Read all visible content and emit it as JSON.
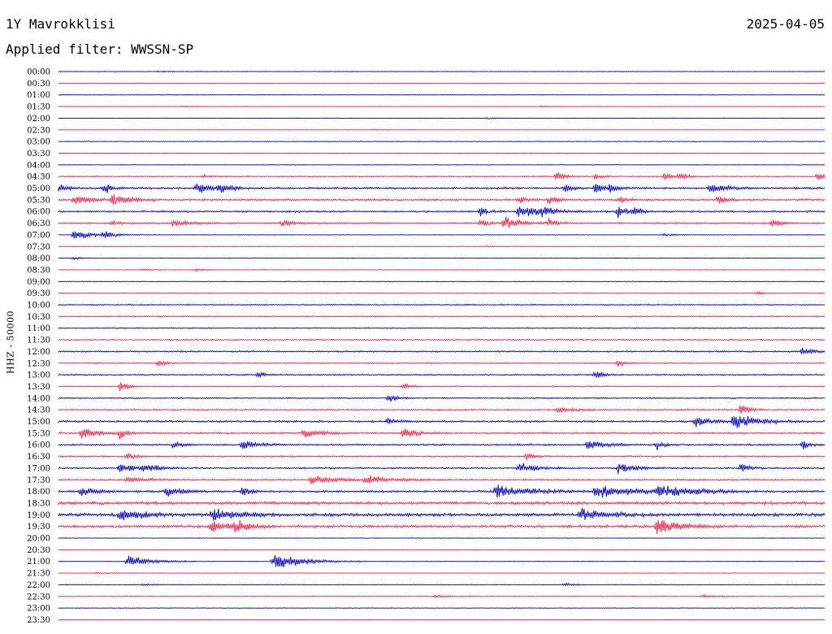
{
  "header": {
    "station": "1Y Mavrokklisi",
    "date": "2025-04-05",
    "filter": "Applied filter: WWSSN-SP"
  },
  "chart_data": {
    "type": "helicorder",
    "ylabel": "HHZ - 50000",
    "line_colors": [
      "#0000cc",
      "#ff1f4b"
    ],
    "rows": [
      {
        "time": "00:00",
        "noise": 0.3,
        "events": [
          {
            "x": 0.13,
            "a": 0.15,
            "w": 0.02
          }
        ]
      },
      {
        "time": "00:30",
        "noise": 0.2,
        "events": []
      },
      {
        "time": "01:00",
        "noise": 0.3,
        "events": []
      },
      {
        "time": "01:30",
        "noise": 0.3,
        "events": [
          {
            "x": 0.16,
            "a": 0.2,
            "w": 0.03
          },
          {
            "x": 0.63,
            "a": 0.2,
            "w": 0.02
          }
        ]
      },
      {
        "time": "02:00",
        "noise": 0.3,
        "events": [
          {
            "x": 0.56,
            "a": 0.3,
            "w": 0.01
          }
        ]
      },
      {
        "time": "02:30",
        "noise": 0.2,
        "events": [
          {
            "x": 0.41,
            "a": 0.15,
            "w": 0.02
          }
        ]
      },
      {
        "time": "03:00",
        "noise": 0.4,
        "events": []
      },
      {
        "time": "03:30",
        "noise": 0.2,
        "events": []
      },
      {
        "time": "04:00",
        "noise": 0.3,
        "events": []
      },
      {
        "time": "04:30",
        "noise": 0.8,
        "events": [
          {
            "x": 0.19,
            "a": 0.4,
            "w": 0.01
          },
          {
            "x": 0.65,
            "a": 1.6,
            "w": 0.01
          },
          {
            "x": 0.7,
            "a": 0.8,
            "w": 0.01
          },
          {
            "x": 0.79,
            "a": 1.5,
            "w": 0.01
          },
          {
            "x": 0.81,
            "a": 1.3,
            "w": 0.01
          },
          {
            "x": 0.99,
            "a": 1.6,
            "w": 0.01
          }
        ]
      },
      {
        "time": "05:00",
        "noise": 1.2,
        "events": [
          {
            "x": 0.0,
            "a": 1.5,
            "w": 0.01
          },
          {
            "x": 0.06,
            "a": 2.0,
            "w": 0.01
          },
          {
            "x": 0.18,
            "a": 1.8,
            "w": 0.02
          },
          {
            "x": 0.21,
            "a": 2.2,
            "w": 0.01
          },
          {
            "x": 0.66,
            "a": 1.6,
            "w": 0.01
          },
          {
            "x": 0.7,
            "a": 1.8,
            "w": 0.01
          },
          {
            "x": 0.72,
            "a": 1.5,
            "w": 0.01
          },
          {
            "x": 0.85,
            "a": 1.5,
            "w": 0.02
          }
        ]
      },
      {
        "time": "05:30",
        "noise": 1.2,
        "events": [
          {
            "x": 0.02,
            "a": 1.5,
            "w": 0.02
          },
          {
            "x": 0.07,
            "a": 2.0,
            "w": 0.02
          },
          {
            "x": 0.6,
            "a": 1.2,
            "w": 0.01
          },
          {
            "x": 0.64,
            "a": 1.5,
            "w": 0.01
          },
          {
            "x": 0.73,
            "a": 1.2,
            "w": 0.01
          },
          {
            "x": 0.86,
            "a": 1.5,
            "w": 0.01
          }
        ]
      },
      {
        "time": "06:00",
        "noise": 1.0,
        "events": [
          {
            "x": 0.55,
            "a": 1.6,
            "w": 0.01
          },
          {
            "x": 0.6,
            "a": 2.0,
            "w": 0.03
          },
          {
            "x": 0.63,
            "a": 1.6,
            "w": 0.01
          },
          {
            "x": 0.73,
            "a": 2.2,
            "w": 0.01
          },
          {
            "x": 0.75,
            "a": 1.8,
            "w": 0.01
          }
        ]
      },
      {
        "time": "06:30",
        "noise": 0.9,
        "events": [
          {
            "x": 0.07,
            "a": 1.2,
            "w": 0.01
          },
          {
            "x": 0.15,
            "a": 1.4,
            "w": 0.02
          },
          {
            "x": 0.29,
            "a": 1.0,
            "w": 0.02
          },
          {
            "x": 0.55,
            "a": 1.5,
            "w": 0.01
          },
          {
            "x": 0.58,
            "a": 2.4,
            "w": 0.02
          },
          {
            "x": 0.64,
            "a": 1.5,
            "w": 0.01
          },
          {
            "x": 0.93,
            "a": 1.6,
            "w": 0.01
          }
        ]
      },
      {
        "time": "07:00",
        "noise": 0.3,
        "events": [
          {
            "x": 0.02,
            "a": 1.6,
            "w": 0.03
          },
          {
            "x": 0.06,
            "a": 1.2,
            "w": 0.01
          },
          {
            "x": 0.79,
            "a": 0.4,
            "w": 0.02
          }
        ]
      },
      {
        "time": "07:30",
        "noise": 0.2,
        "events": [
          {
            "x": 0.56,
            "a": 0.2,
            "w": 0.02
          }
        ]
      },
      {
        "time": "08:00",
        "noise": 0.4,
        "events": [
          {
            "x": 0.02,
            "a": 0.6,
            "w": 0.01
          }
        ]
      },
      {
        "time": "08:30",
        "noise": 0.3,
        "events": [
          {
            "x": 0.11,
            "a": 0.4,
            "w": 0.01
          },
          {
            "x": 0.18,
            "a": 0.5,
            "w": 0.01
          }
        ]
      },
      {
        "time": "09:00",
        "noise": 0.3,
        "events": []
      },
      {
        "time": "09:30",
        "noise": 0.3,
        "events": [
          {
            "x": 0.91,
            "a": 0.6,
            "w": 0.01
          }
        ]
      },
      {
        "time": "10:00",
        "noise": 0.7,
        "events": []
      },
      {
        "time": "10:30",
        "noise": 0.7,
        "events": []
      },
      {
        "time": "11:00",
        "noise": 0.7,
        "events": []
      },
      {
        "time": "11:30",
        "noise": 0.8,
        "events": []
      },
      {
        "time": "12:00",
        "noise": 0.9,
        "events": [
          {
            "x": 0.97,
            "a": 1.0,
            "w": 0.02
          }
        ]
      },
      {
        "time": "12:30",
        "noise": 0.7,
        "events": [
          {
            "x": 0.13,
            "a": 1.0,
            "w": 0.01
          },
          {
            "x": 0.73,
            "a": 1.1,
            "w": 0.01
          }
        ]
      },
      {
        "time": "13:00",
        "noise": 0.8,
        "events": [
          {
            "x": 0.26,
            "a": 1.0,
            "w": 0.01
          },
          {
            "x": 0.7,
            "a": 1.5,
            "w": 0.01
          }
        ]
      },
      {
        "time": "13:30",
        "noise": 0.6,
        "events": [
          {
            "x": 0.08,
            "a": 1.5,
            "w": 0.01
          },
          {
            "x": 0.45,
            "a": 1.2,
            "w": 0.01
          }
        ]
      },
      {
        "time": "14:00",
        "noise": 0.8,
        "events": [
          {
            "x": 0.43,
            "a": 1.4,
            "w": 0.01
          }
        ]
      },
      {
        "time": "14:30",
        "noise": 0.9,
        "events": [
          {
            "x": 0.65,
            "a": 1.0,
            "w": 0.02
          },
          {
            "x": 0.89,
            "a": 1.8,
            "w": 0.01
          }
        ]
      },
      {
        "time": "15:00",
        "noise": 1.1,
        "events": [
          {
            "x": 0.43,
            "a": 1.2,
            "w": 0.01
          },
          {
            "x": 0.83,
            "a": 1.6,
            "w": 0.02
          },
          {
            "x": 0.88,
            "a": 2.6,
            "w": 0.03
          }
        ]
      },
      {
        "time": "15:30",
        "noise": 1.0,
        "events": [
          {
            "x": 0.03,
            "a": 2.0,
            "w": 0.02
          },
          {
            "x": 0.08,
            "a": 1.8,
            "w": 0.01
          },
          {
            "x": 0.32,
            "a": 2.0,
            "w": 0.02
          },
          {
            "x": 0.45,
            "a": 1.6,
            "w": 0.02
          }
        ]
      },
      {
        "time": "16:00",
        "noise": 1.0,
        "events": [
          {
            "x": 0.15,
            "a": 1.2,
            "w": 0.01
          },
          {
            "x": 0.24,
            "a": 1.6,
            "w": 0.02
          },
          {
            "x": 0.69,
            "a": 1.8,
            "w": 0.02
          },
          {
            "x": 0.78,
            "a": 1.5,
            "w": 0.01
          },
          {
            "x": 0.97,
            "a": 1.5,
            "w": 0.01
          }
        ]
      },
      {
        "time": "16:30",
        "noise": 0.9,
        "events": [
          {
            "x": 0.09,
            "a": 1.4,
            "w": 0.01
          },
          {
            "x": 0.61,
            "a": 1.2,
            "w": 0.01
          }
        ]
      },
      {
        "time": "17:00",
        "noise": 1.0,
        "events": [
          {
            "x": 0.08,
            "a": 1.6,
            "w": 0.02
          },
          {
            "x": 0.11,
            "a": 1.4,
            "w": 0.02
          },
          {
            "x": 0.6,
            "a": 1.6,
            "w": 0.02
          },
          {
            "x": 0.73,
            "a": 1.7,
            "w": 0.02
          },
          {
            "x": 0.89,
            "a": 1.5,
            "w": 0.01
          }
        ]
      },
      {
        "time": "17:30",
        "noise": 1.0,
        "events": [
          {
            "x": 0.09,
            "a": 1.2,
            "w": 0.02
          },
          {
            "x": 0.33,
            "a": 1.4,
            "w": 0.03
          },
          {
            "x": 0.4,
            "a": 1.5,
            "w": 0.03
          }
        ]
      },
      {
        "time": "18:00",
        "noise": 1.2,
        "events": [
          {
            "x": 0.03,
            "a": 1.5,
            "w": 0.02
          },
          {
            "x": 0.14,
            "a": 1.6,
            "w": 0.02
          },
          {
            "x": 0.24,
            "a": 1.4,
            "w": 0.01
          },
          {
            "x": 0.57,
            "a": 2.0,
            "w": 0.05
          },
          {
            "x": 0.7,
            "a": 1.8,
            "w": 0.06
          },
          {
            "x": 0.78,
            "a": 1.7,
            "w": 0.05
          }
        ]
      },
      {
        "time": "18:30",
        "noise": 1.8,
        "events": []
      },
      {
        "time": "19:00",
        "noise": 1.9,
        "events": [
          {
            "x": 0.08,
            "a": 2.2,
            "w": 0.03
          },
          {
            "x": 0.2,
            "a": 2.3,
            "w": 0.03
          },
          {
            "x": 0.68,
            "a": 2.0,
            "w": 0.03
          }
        ]
      },
      {
        "time": "19:30",
        "noise": 1.5,
        "events": [
          {
            "x": 0.2,
            "a": 2.0,
            "w": 0.02
          },
          {
            "x": 0.23,
            "a": 1.8,
            "w": 0.02
          },
          {
            "x": 0.78,
            "a": 2.6,
            "w": 0.03
          }
        ]
      },
      {
        "time": "20:00",
        "noise": 0.3,
        "events": []
      },
      {
        "time": "20:30",
        "noise": 0.3,
        "events": []
      },
      {
        "time": "21:00",
        "noise": 0.3,
        "events": [
          {
            "x": 0.09,
            "a": 2.0,
            "w": 0.03
          },
          {
            "x": 0.28,
            "a": 2.6,
            "w": 0.04
          }
        ]
      },
      {
        "time": "21:30",
        "noise": 0.3,
        "events": [
          {
            "x": 0.05,
            "a": 0.3,
            "w": 0.02
          }
        ]
      },
      {
        "time": "22:00",
        "noise": 0.4,
        "events": [
          {
            "x": 0.11,
            "a": 0.5,
            "w": 0.01
          },
          {
            "x": 0.66,
            "a": 0.6,
            "w": 0.01
          }
        ]
      },
      {
        "time": "22:30",
        "noise": 0.4,
        "events": [
          {
            "x": 0.49,
            "a": 0.4,
            "w": 0.02
          },
          {
            "x": 0.84,
            "a": 0.4,
            "w": 0.02
          }
        ]
      },
      {
        "time": "23:00",
        "noise": 0.4,
        "events": []
      },
      {
        "time": "23:30",
        "noise": 0.3,
        "events": []
      }
    ]
  }
}
